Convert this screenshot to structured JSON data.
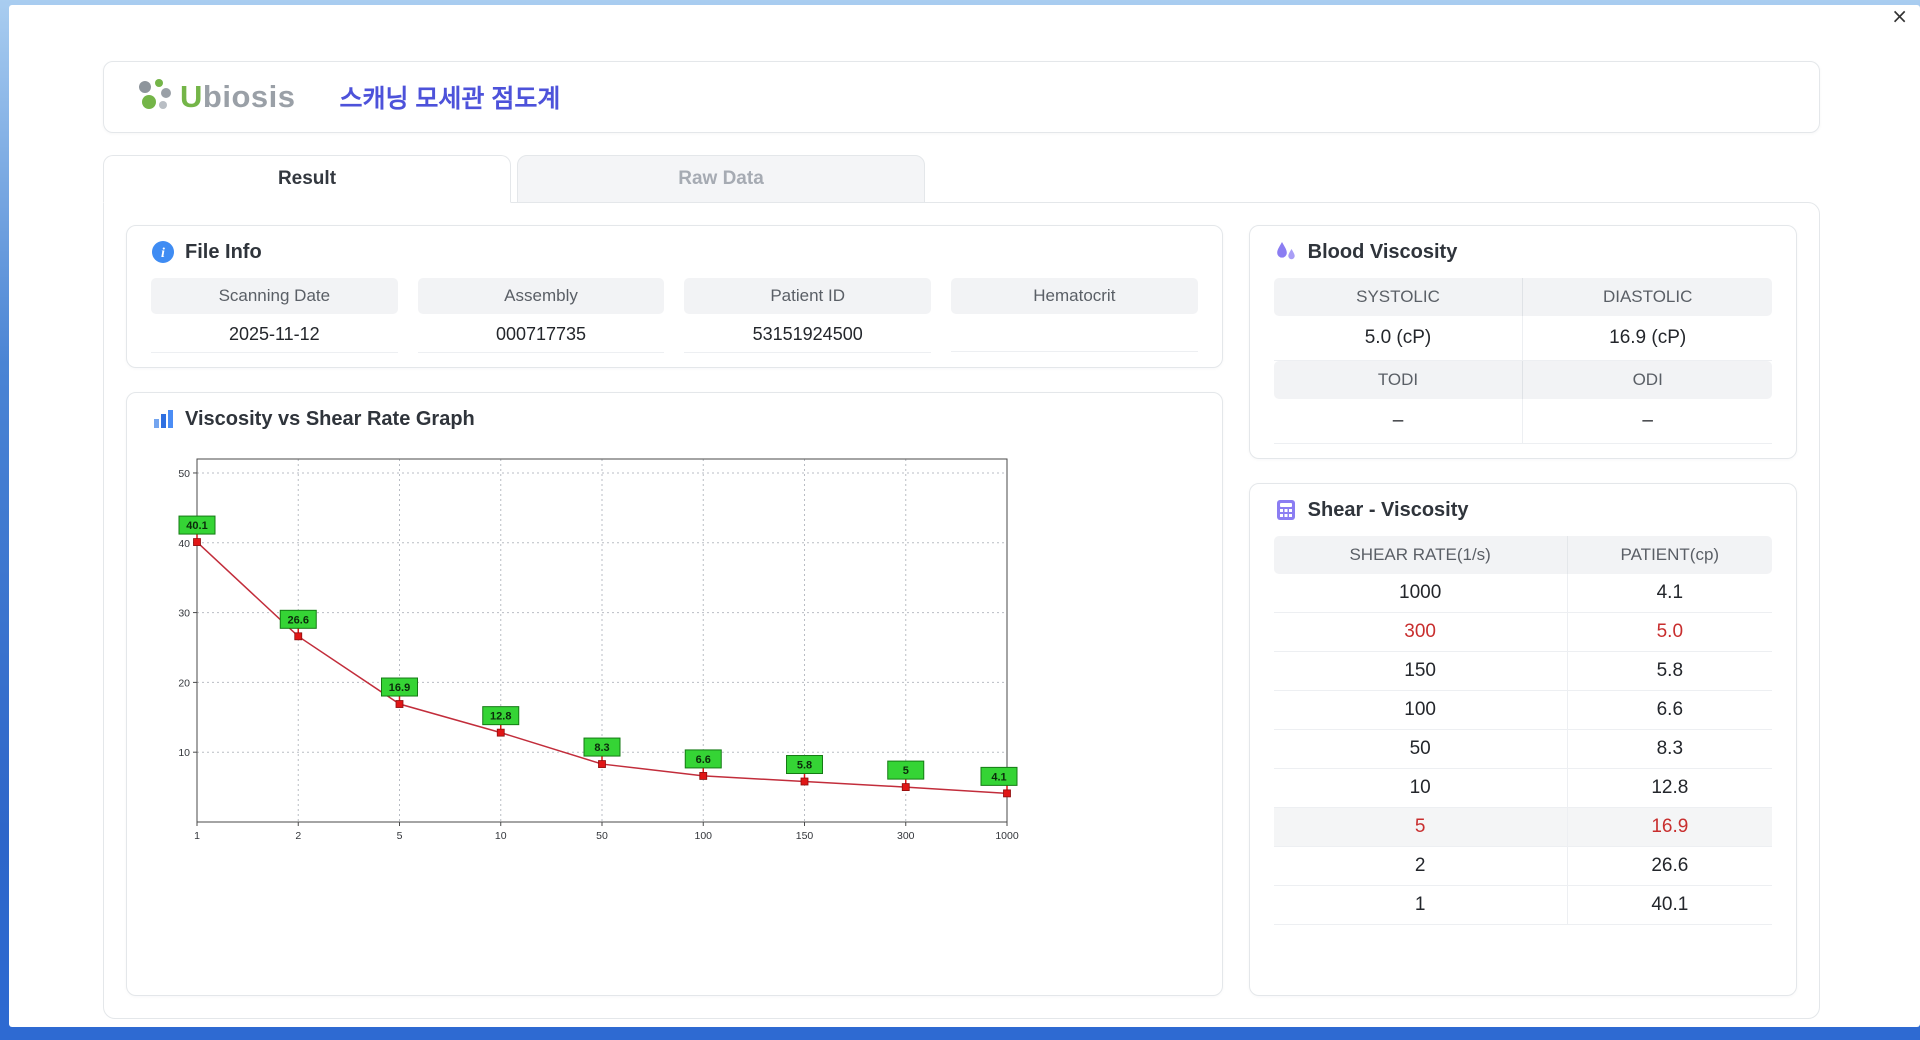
{
  "window": {
    "close_label": "×"
  },
  "header": {
    "logo_u": "U",
    "logo_rest": "biosis",
    "title": "스캐닝 모세관 점도계"
  },
  "tabs": [
    {
      "label": "Result",
      "active": true
    },
    {
      "label": "Raw Data",
      "active": false
    }
  ],
  "file_info": {
    "title": "File Info",
    "fields": [
      {
        "label": "Scanning Date",
        "value": "2025-11-12"
      },
      {
        "label": "Assembly",
        "value": "000717735"
      },
      {
        "label": "Patient ID",
        "value": "53151924500"
      },
      {
        "label": "Hematocrit",
        "value": ""
      }
    ]
  },
  "blood_viscosity": {
    "title": "Blood Viscosity",
    "rows": [
      {
        "headers": [
          "SYSTOLIC",
          "DIASTOLIC"
        ],
        "values": [
          "5.0 (cP)",
          "16.9 (cP)"
        ]
      },
      {
        "headers": [
          "TODI",
          "ODI"
        ],
        "values": [
          "–",
          "–"
        ]
      }
    ]
  },
  "graph": {
    "title": "Viscosity vs Shear Rate Graph"
  },
  "chart_data": {
    "type": "line",
    "title": "Viscosity vs Shear Rate Graph",
    "x_scale": "categorical-log",
    "x": [
      1,
      2,
      5,
      10,
      50,
      100,
      150,
      300,
      1000
    ],
    "x_ticks": [
      "1",
      "2",
      "5",
      "10",
      "50",
      "100",
      "150",
      "300",
      "1000"
    ],
    "values": [
      40.1,
      26.6,
      16.9,
      12.8,
      8.3,
      6.6,
      5.8,
      5,
      4.1
    ],
    "point_labels": [
      "40.1",
      "26.6",
      "16.9",
      "12.8",
      "8.3",
      "6.6",
      "5.8",
      "5",
      "4.1"
    ],
    "ylim": [
      0,
      52
    ],
    "y_ticks": [
      10,
      20,
      30,
      40,
      50
    ],
    "grid": "dotted",
    "xlabel": "",
    "ylabel": "",
    "line_color": "#c22d3b",
    "marker_color": "#e01616",
    "marker_border": "#8c0d0d",
    "label_bg": "#35d435",
    "label_border": "#147a14",
    "label_text_color": "#0b2b0b"
  },
  "shear_table": {
    "title": "Shear - Viscosity",
    "columns": [
      "SHEAR RATE(1/s)",
      "PATIENT(cp)"
    ],
    "rows": [
      {
        "rate": "1000",
        "value": "4.1",
        "highlight": false,
        "shaded": false
      },
      {
        "rate": "300",
        "value": "5.0",
        "highlight": true,
        "shaded": false
      },
      {
        "rate": "150",
        "value": "5.8",
        "highlight": false,
        "shaded": false
      },
      {
        "rate": "100",
        "value": "6.6",
        "highlight": false,
        "shaded": false
      },
      {
        "rate": "50",
        "value": "8.3",
        "highlight": false,
        "shaded": false
      },
      {
        "rate": "10",
        "value": "12.8",
        "highlight": false,
        "shaded": false
      },
      {
        "rate": "5",
        "value": "16.9",
        "highlight": true,
        "shaded": true
      },
      {
        "rate": "2",
        "value": "26.6",
        "highlight": false,
        "shaded": false
      },
      {
        "rate": "1",
        "value": "40.1",
        "highlight": false,
        "shaded": false
      }
    ]
  },
  "colors": {
    "accent_blue": "#3f8cf3",
    "accent_purple": "#8b7df2",
    "brand_green": "#74b548",
    "title_blue": "#4d52da",
    "highlight_red": "#c82e2e"
  }
}
